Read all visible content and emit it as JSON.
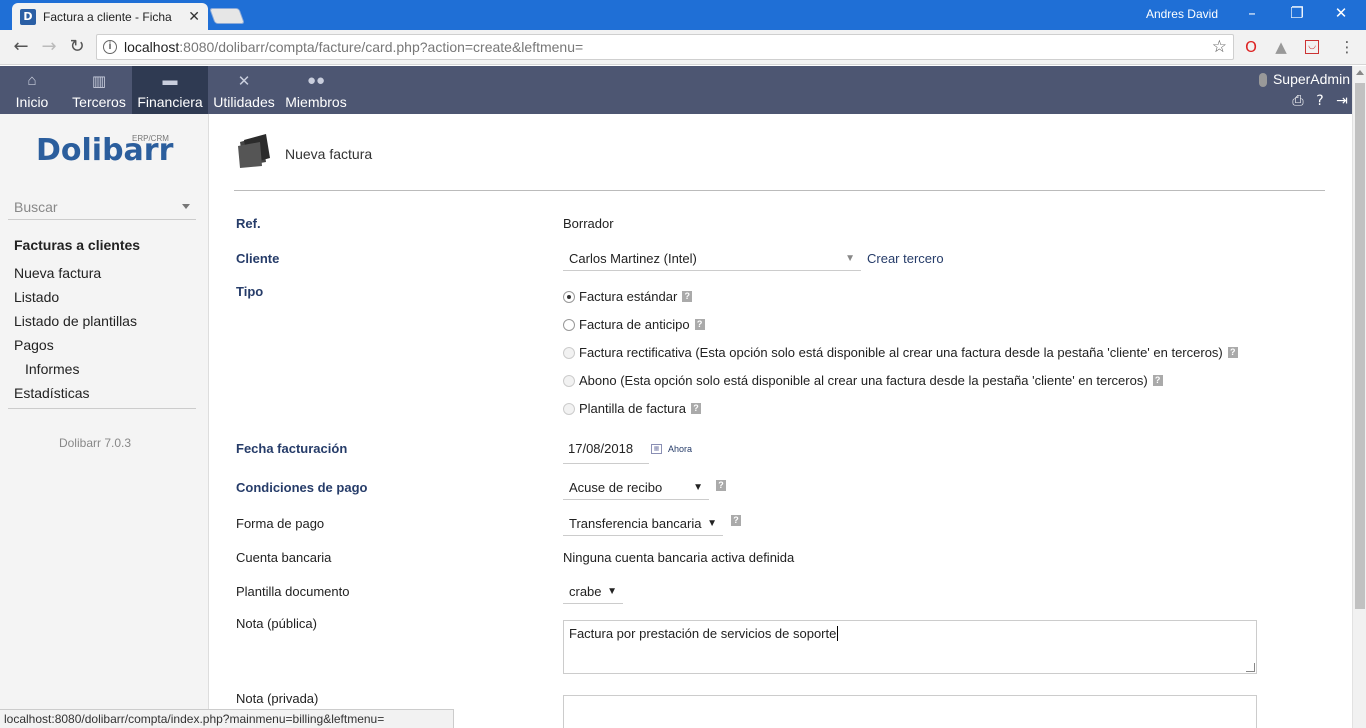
{
  "browser": {
    "tab_title": "Factura a cliente - Ficha",
    "tab_favicon_letter": "D",
    "window_user": "Andres David",
    "url_host": "localhost",
    "url_rest": ":8080/dolibarr/compta/facture/card.php?action=create&leftmenu=",
    "status_url": "localhost:8080/dolibarr/compta/index.php?mainmenu=billing&leftmenu="
  },
  "topmenu": {
    "items": [
      {
        "label": "Inicio",
        "icon": "home-icon"
      },
      {
        "label": "Terceros",
        "icon": "building-icon"
      },
      {
        "label": "Financiera",
        "icon": "coins-icon"
      },
      {
        "label": "Utilidades",
        "icon": "tools-icon"
      },
      {
        "label": "Miembros",
        "icon": "members-icon"
      }
    ],
    "active": "Financiera",
    "user": "SuperAdmin"
  },
  "sidebar": {
    "logo": "Dolibarr",
    "logo_sub": "ERP/CRM",
    "search_placeholder": "Buscar",
    "section_title": "Facturas a clientes",
    "links": [
      "Nueva factura",
      "Listado",
      "Listado de plantillas",
      "Pagos",
      "Informes",
      "Estadísticas"
    ],
    "version": "Dolibarr 7.0.3"
  },
  "form": {
    "title": "Nueva factura",
    "ref_label": "Ref.",
    "ref_value": "Borrador",
    "cliente_label": "Cliente",
    "cliente_value": "Carlos Martinez (Intel)",
    "crear_tercero": "Crear tercero",
    "tipo_label": "Tipo",
    "tipo_options": [
      {
        "label": "Factura estándar",
        "selected": true,
        "disabled": false
      },
      {
        "label": "Factura de anticipo",
        "selected": false,
        "disabled": false
      },
      {
        "label": "Factura rectificativa (Esta opción solo está disponible al crear una factura desde la pestaña 'cliente' en terceros)",
        "selected": false,
        "disabled": true
      },
      {
        "label": "Abono (Esta opción solo está disponible al crear una factura desde la pestaña 'cliente' en terceros)",
        "selected": false,
        "disabled": true
      },
      {
        "label": "Plantilla de factura",
        "selected": false,
        "disabled": true
      }
    ],
    "fecha_label": "Fecha facturación",
    "fecha_value": "17/08/2018",
    "ahora": "Ahora",
    "condiciones_label": "Condiciones de pago",
    "condiciones_value": "Acuse de recibo",
    "forma_label": "Forma de pago",
    "forma_value": "Transferencia bancaria",
    "cuenta_label": "Cuenta bancaria",
    "cuenta_value": "Ninguna cuenta bancaria activa definida",
    "plantilla_label": "Plantilla documento",
    "plantilla_value": "crabe",
    "nota_publica_label": "Nota (pública)",
    "nota_publica_value": "Factura por prestación de servicios de soporte",
    "nota_privada_label": "Nota (privada)",
    "nota_privada_value": ""
  },
  "colors": {
    "menu_bg": "#4d5672",
    "menu_active": "#2f3a52",
    "label_required": "#263c69",
    "chrome_blue": "#1f6fd6"
  }
}
